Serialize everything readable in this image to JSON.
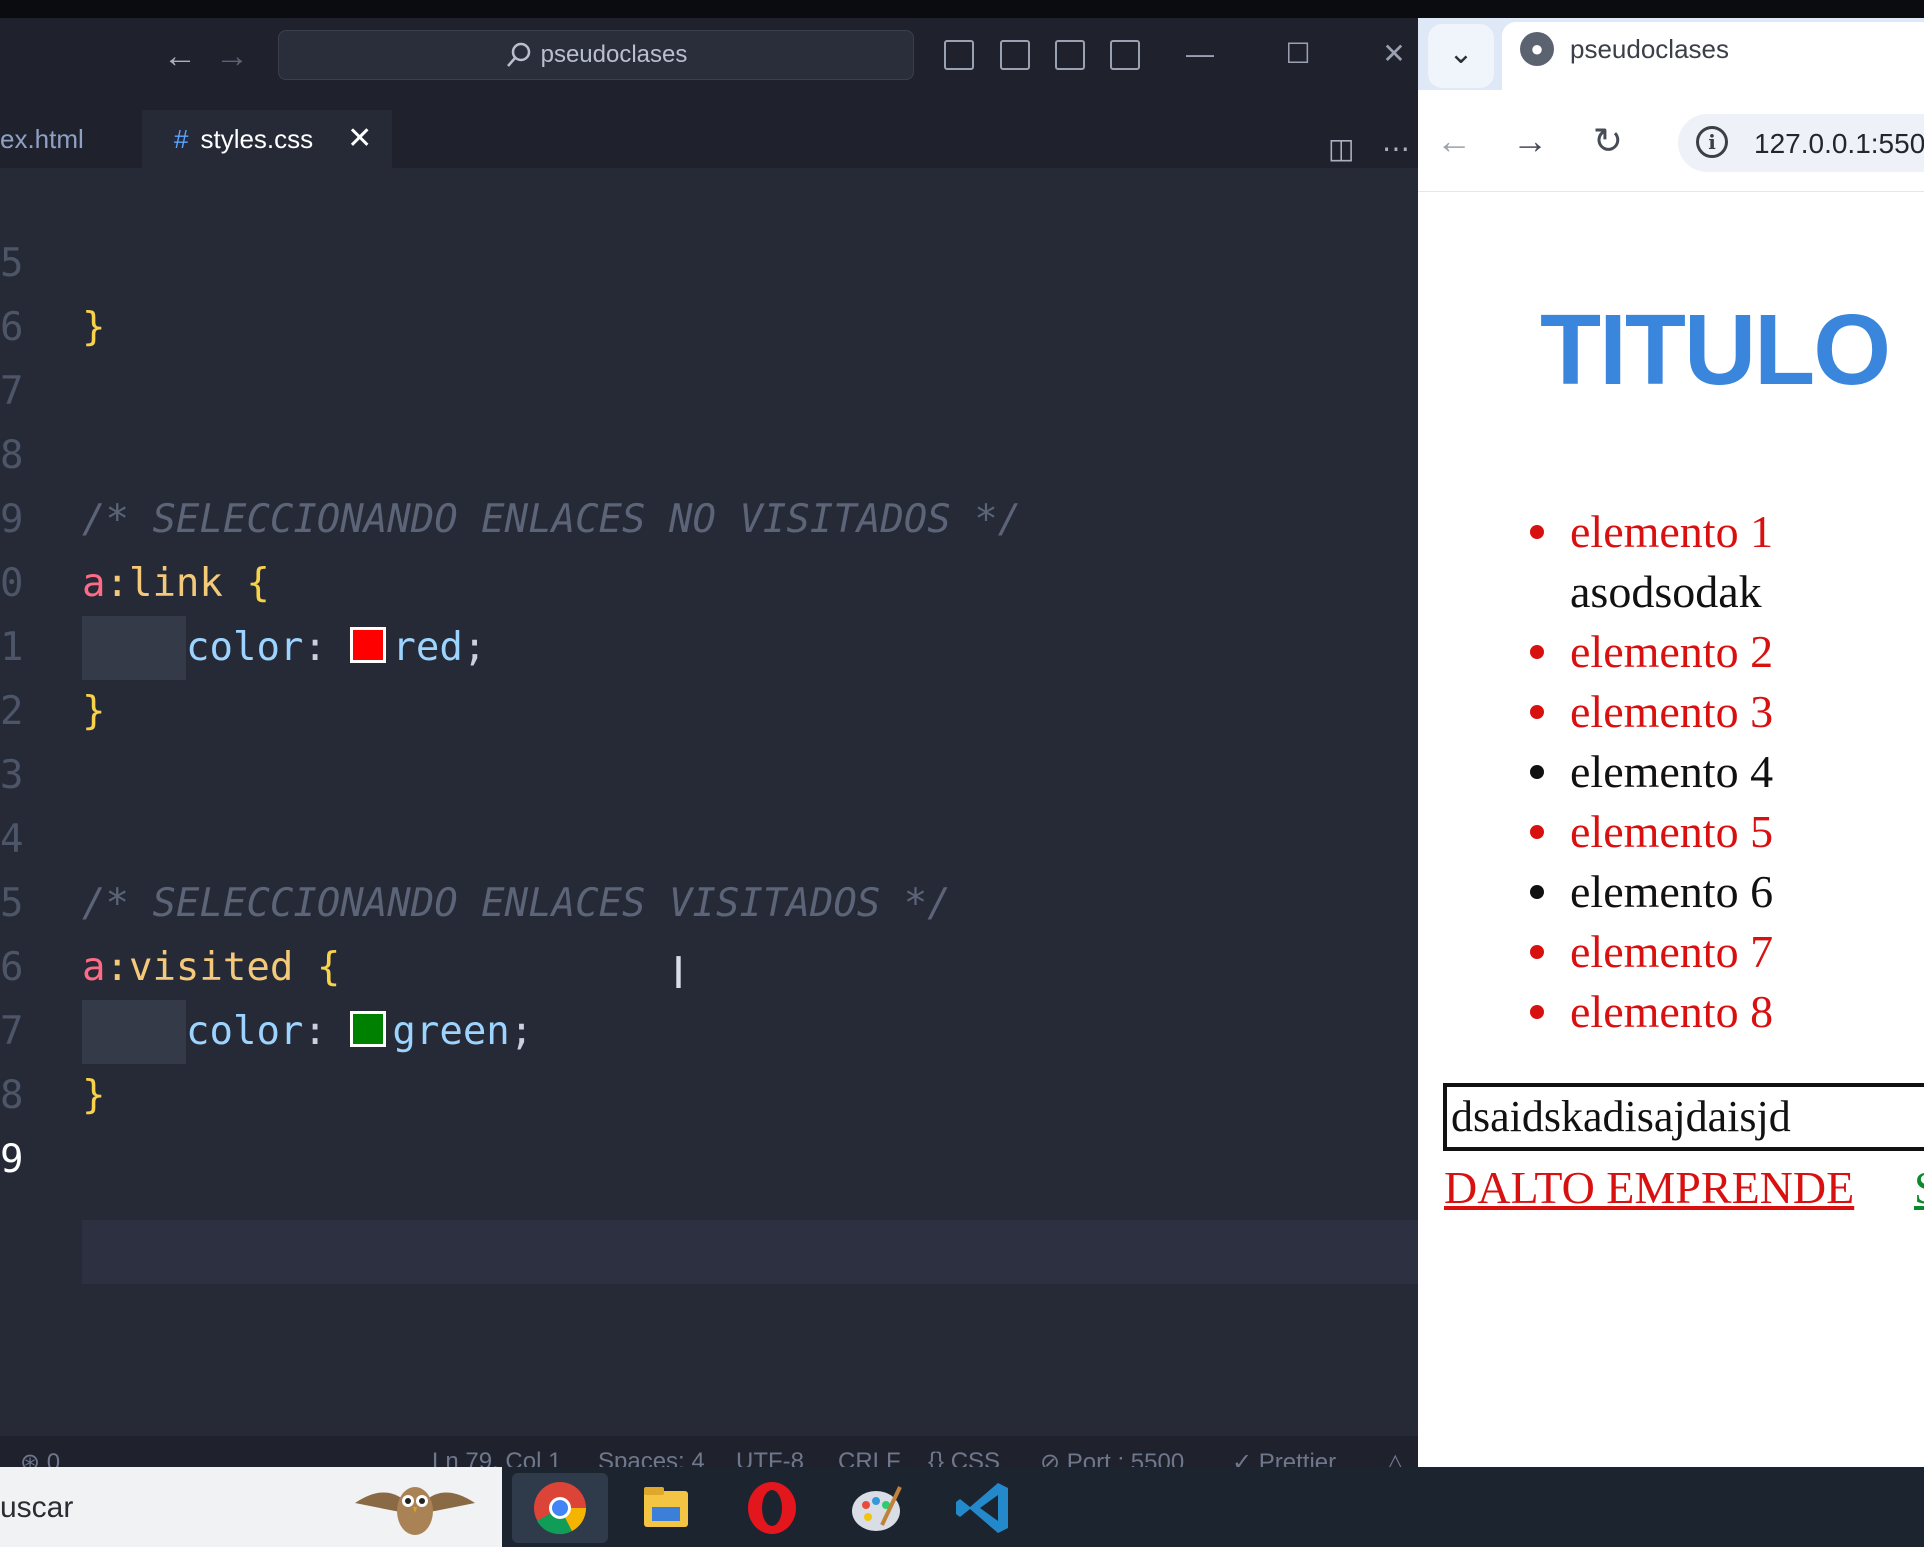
{
  "vscode": {
    "search_text": "pseudoclases",
    "tabs": [
      {
        "label": "ex.html"
      },
      {
        "label": "styles.css",
        "icon": "#"
      }
    ],
    "line_numbers": [
      "5",
      "6",
      "7",
      "8",
      "9",
      "0",
      "1",
      "2",
      "3",
      "4",
      "5",
      "6",
      "7",
      "8",
      "9"
    ],
    "code": {
      "l5_brace": "}",
      "comment1": "/* SELECCIONANDO ENLACES NO VISITADOS */",
      "sel1_tag": "a",
      "sel1_pc": ":link",
      "open_brace": "{",
      "prop": "color",
      "colon": ":",
      "val1": "red",
      "semi": ";",
      "close_brace": "}",
      "comment2": "/* SELECCIONANDO ENLACES VISITADOS */",
      "sel2_tag": "a",
      "sel2_pc": ":visited",
      "val2": "green",
      "swatch1_color": "#ff0000",
      "swatch2_color": "#008000"
    },
    "status": {
      "ports": "0",
      "position": "Ln 79, Col 1",
      "spaces": "Spaces: 4",
      "encoding": "UTF-8",
      "eol": "CRLF",
      "language": "CSS",
      "port": "Port : 5500",
      "formatter": "Prettier"
    }
  },
  "browser": {
    "tab_title": "pseudoclases",
    "url": "127.0.0.1:550",
    "page": {
      "title": "TITULO",
      "items": [
        {
          "text": "elemento 1",
          "color": "red"
        },
        {
          "text": "asodsodak",
          "color": "plain"
        },
        {
          "text": "elemento 2",
          "color": "red"
        },
        {
          "text": "elemento 3",
          "color": "red"
        },
        {
          "text": "elemento 4",
          "color": "black"
        },
        {
          "text": "elemento 5",
          "color": "red"
        },
        {
          "text": "elemento 6",
          "color": "black"
        },
        {
          "text": "elemento 7",
          "color": "red"
        },
        {
          "text": "elemento 8",
          "color": "red"
        }
      ],
      "input_value": "dsaidskadisajdaisjd",
      "link1": "DALTO EMPRENDE",
      "link2": "S"
    }
  },
  "taskbar": {
    "search_text": "uscar",
    "apps": [
      "chrome-icon",
      "file-explorer-icon",
      "opera-icon",
      "paint-icon",
      "vscode-icon"
    ]
  }
}
